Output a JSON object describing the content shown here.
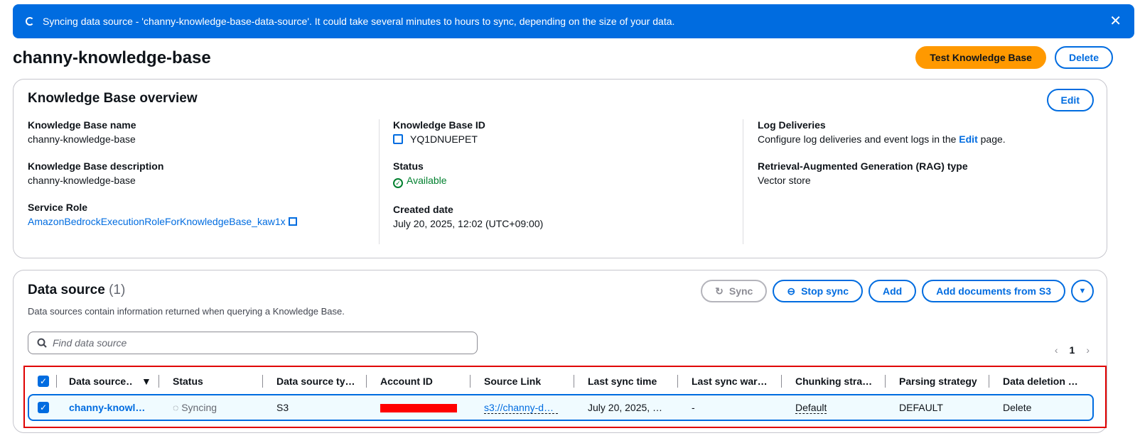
{
  "banner": {
    "message": "Syncing data source - 'channy-knowledge-base-data-source'. It could take several minutes to hours to sync, depending on the size of your data.",
    "close_glyph": "✕"
  },
  "page": {
    "title": "channy-knowledge-base",
    "test_button": "Test Knowledge Base",
    "delete_button": "Delete"
  },
  "overview": {
    "title": "Knowledge Base overview",
    "edit_button": "Edit",
    "kb_name_label": "Knowledge Base name",
    "kb_name": "channy-knowledge-base",
    "kb_desc_label": "Knowledge Base description",
    "kb_desc": "channy-knowledge-base",
    "service_role_label": "Service Role",
    "service_role": "AmazonBedrockExecutionRoleForKnowledgeBase_kaw1x",
    "kb_id_label": "Knowledge Base ID",
    "kb_id": "YQ1DNUEPET",
    "status_label": "Status",
    "status": "Available",
    "created_label": "Created date",
    "created": "July 20, 2025, 12:02 (UTC+09:00)",
    "log_label": "Log Deliveries",
    "log_text_pre": "Configure log deliveries and event logs in the ",
    "log_link": "Edit",
    "log_text_post": " page.",
    "rag_label": "Retrieval-Augmented Generation (RAG) type",
    "rag": "Vector store"
  },
  "datasource": {
    "title": "Data source",
    "count": "(1)",
    "description": "Data sources contain information returned when querying a Knowledge Base.",
    "sync_button": "Sync",
    "stop_sync_button": "Stop sync",
    "add_button": "Add",
    "add_docs_button": "Add documents from S3",
    "search_placeholder": "Find data source",
    "page_number": "1",
    "columns": [
      "Data source…",
      "Status",
      "Data source ty…",
      "Account ID",
      "Source Link",
      "Last sync time",
      "Last sync war…",
      "Chunking stra…",
      "Parsing strategy",
      "Data deletion …"
    ],
    "row": {
      "name": "channy-knowl…",
      "status": "Syncing",
      "type": "S3",
      "source_link": "s3://channy-d…",
      "last_sync": "July 20, 2025, …",
      "warnings": "-",
      "chunking": "Default",
      "parsing": "DEFAULT",
      "deletion": "Delete"
    }
  },
  "colors": {
    "accent": "#006ce0",
    "primary_button": "#ff9900",
    "success": "#00802f",
    "highlight_frame": "#e00000"
  }
}
